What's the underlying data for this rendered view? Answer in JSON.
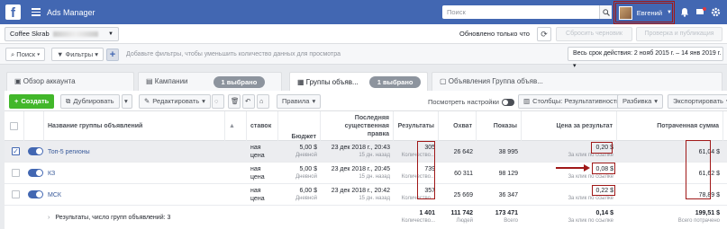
{
  "topbar": {
    "logo": "f",
    "app_title": "Ads Manager",
    "search_placeholder": "Поиск",
    "user_name": "Евгений"
  },
  "account_bar": {
    "account_name": "Coffee Skrab",
    "updated_text": "Обновлено только что",
    "discard_label": "Сбросить черновик",
    "review_label": "Проверка и публикация"
  },
  "filter_bar": {
    "search_label": "Поиск",
    "filters_label": "Фильтры",
    "hint": "Добавьте фильтры, чтобы уменьшить количество данных для просмотра",
    "date_range": "Весь срок действия: 2 нояб 2015 г. – 14 янв 2019 г."
  },
  "tabs": [
    {
      "label": "Обзор аккаунта"
    },
    {
      "label": "Кампании",
      "badge": "1 выбрано"
    },
    {
      "label": "Группы объяв...",
      "badge": "1 выбрано"
    },
    {
      "label": "Объявления Группа объяв..."
    }
  ],
  "toolbar": {
    "create": "Создать",
    "duplicate": "Дублировать",
    "edit": "Редактировать",
    "rules": "Правила",
    "view_settings": "Посмотреть настройки",
    "columns": "Столбцы: Результативность",
    "breakdown": "Разбивка",
    "export": "Экспортировать"
  },
  "table": {
    "headers": {
      "name": "Название группы объявлений",
      "bid": "ставок",
      "budget": "Бюджет",
      "last_edit": "Последняя существенная правка",
      "results": "Результаты",
      "reach": "Охват",
      "impressions": "Показы",
      "cost_per_result": "Цена за результат",
      "amount_spent": "Потраченная сумма"
    },
    "rows": [
      {
        "name": "Топ-5 регионы",
        "bid": "ная цена",
        "budget": "5,00 $",
        "budget_sub": "Дневной",
        "edit": "23 дек 2018 г., 20:43",
        "edit_sub": "15 дн. назад",
        "results": "305",
        "results_sub": "Количество...",
        "reach": "26 642",
        "impressions": "38 995",
        "cpr": "0,20 $",
        "cpr_sub": "За клик по ссылке",
        "spent": "61,04 $"
      },
      {
        "name": "КЗ",
        "bid": "ная цена",
        "budget": "5,00 $",
        "budget_sub": "Дневной",
        "edit": "23 дек 2018 г., 20:45",
        "edit_sub": "15 дн. назад",
        "results": "739",
        "results_sub": "Количество...",
        "reach": "60 311",
        "impressions": "98 129",
        "cpr": "0,08 $",
        "cpr_sub": "За клик по ссылке",
        "spent": "61,62 $"
      },
      {
        "name": "МСК",
        "bid": "ная цена",
        "budget": "6,00 $",
        "budget_sub": "Дневной",
        "edit": "23 дек 2018 г., 20:42",
        "edit_sub": "15 дн. назад",
        "results": "357",
        "results_sub": "Количество...",
        "reach": "25 669",
        "impressions": "36 347",
        "cpr": "0,22 $",
        "cpr_sub": "За клик по ссылке",
        "spent": "78,89 $"
      }
    ],
    "totals": {
      "label": "Результаты, число групп объявлений: 3",
      "results": "1 401",
      "results_sub": "Количество...",
      "reach": "111 742",
      "reach_sub": "Людей",
      "impressions": "173 471",
      "impressions_sub": "Всего",
      "cpr": "0,14 $",
      "cpr_sub": "За клик по ссылке",
      "spent": "199,51 $",
      "spent_sub": "Всего потрачено"
    }
  },
  "colors": {
    "brand": "#4267b2",
    "annotation": "#a01818",
    "create": "#42b72a"
  }
}
